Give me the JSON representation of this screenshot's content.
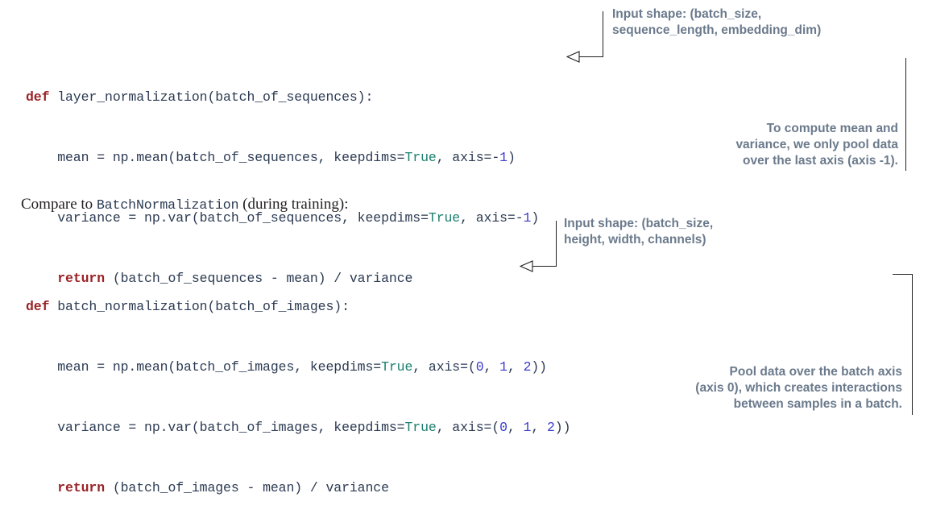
{
  "page": {
    "background": "#ffffff",
    "code_color": "#2b3a52",
    "keyword_color": "#9b2226",
    "boolean_color": "#1b7f6e",
    "number_color": "#3b3bcf",
    "callout_color": "#6b7a8c",
    "prose_color": "#231f20",
    "rule_color": "#231f20"
  },
  "code_blocks": [
    {
      "id": "layer-normalization",
      "lines": [
        [
          {
            "t": "def",
            "c": "kw"
          },
          {
            "t": " layer_normalization(batch_of_sequences):",
            "c": "plain"
          }
        ],
        [
          {
            "t": "    mean = np.mean(batch_of_sequences, keepdims=",
            "c": "plain"
          },
          {
            "t": "True",
            "c": "bool"
          },
          {
            "t": ", axis=-",
            "c": "plain"
          },
          {
            "t": "1",
            "c": "num"
          },
          {
            "t": ")",
            "c": "plain"
          }
        ],
        [
          {
            "t": "    variance = np.var(batch_of_sequences, keepdims=",
            "c": "plain"
          },
          {
            "t": "True",
            "c": "bool"
          },
          {
            "t": ", axis=-",
            "c": "plain"
          },
          {
            "t": "1",
            "c": "num"
          },
          {
            "t": ")",
            "c": "plain"
          }
        ],
        [
          {
            "t": "    ",
            "c": "plain"
          },
          {
            "t": "return",
            "c": "kw"
          },
          {
            "t": " (batch_of_sequences - mean) / variance",
            "c": "plain"
          }
        ]
      ]
    },
    {
      "id": "batch-normalization",
      "lines": [
        [
          {
            "t": "def",
            "c": "kw"
          },
          {
            "t": " batch_normalization(batch_of_images):",
            "c": "plain"
          }
        ],
        [
          {
            "t": "    mean = np.mean(batch_of_images, keepdims=",
            "c": "plain"
          },
          {
            "t": "True",
            "c": "bool"
          },
          {
            "t": ", axis=(",
            "c": "plain"
          },
          {
            "t": "0",
            "c": "num"
          },
          {
            "t": ", ",
            "c": "plain"
          },
          {
            "t": "1",
            "c": "num"
          },
          {
            "t": ", ",
            "c": "plain"
          },
          {
            "t": "2",
            "c": "num"
          },
          {
            "t": "))",
            "c": "plain"
          }
        ],
        [
          {
            "t": "    variance = np.var(batch_of_images, keepdims=",
            "c": "plain"
          },
          {
            "t": "True",
            "c": "bool"
          },
          {
            "t": ", axis=(",
            "c": "plain"
          },
          {
            "t": "0",
            "c": "num"
          },
          {
            "t": ", ",
            "c": "plain"
          },
          {
            "t": "1",
            "c": "num"
          },
          {
            "t": ", ",
            "c": "plain"
          },
          {
            "t": "2",
            "c": "num"
          },
          {
            "t": "))",
            "c": "plain"
          }
        ],
        [
          {
            "t": "    ",
            "c": "plain"
          },
          {
            "t": "return",
            "c": "kw"
          },
          {
            "t": " (batch_of_images - mean) / variance",
            "c": "plain"
          }
        ]
      ]
    }
  ],
  "prose": {
    "compare_prefix": "Compare to ",
    "compare_mono": "BatchNormalization",
    "compare_suffix": " (during training):"
  },
  "callouts": {
    "layer_input_shape": "Input shape: (batch_size,\nsequence_length, embedding_dim)",
    "layer_axis_note": "To compute mean and\nvariance, we only pool data\nover the last axis (axis -1).",
    "batch_input_shape": "Input shape: (batch_size,\nheight, width, channels)",
    "batch_axis_note": "Pool data over the batch axis\n(axis 0), which creates interactions\nbetween samples in a batch."
  }
}
